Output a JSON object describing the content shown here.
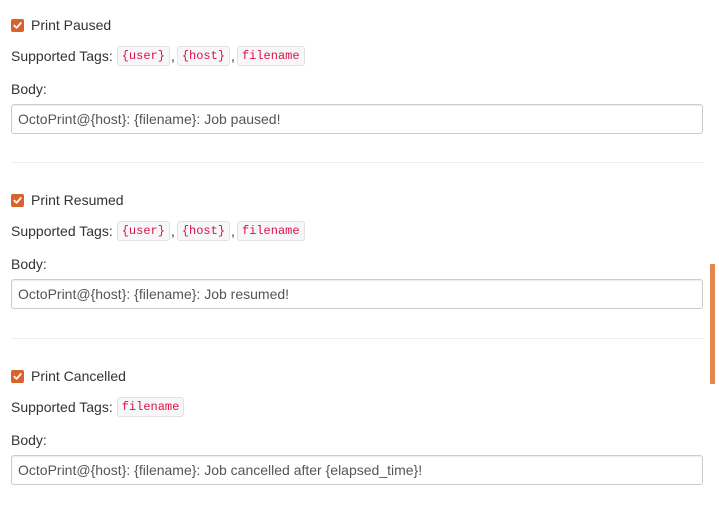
{
  "sections": [
    {
      "checkbox_label": "Print Paused",
      "checked": true,
      "tags_label": "Supported Tags:",
      "tags": [
        "{user}",
        "{host}",
        "filename"
      ],
      "body_label": "Body:",
      "body_value": "OctoPrint@{host}: {filename}: Job paused!"
    },
    {
      "checkbox_label": "Print Resumed",
      "checked": true,
      "tags_label": "Supported Tags:",
      "tags": [
        "{user}",
        "{host}",
        "filename"
      ],
      "body_label": "Body:",
      "body_value": "OctoPrint@{host}: {filename}: Job resumed!"
    },
    {
      "checkbox_label": "Print Cancelled",
      "checked": true,
      "tags_label": "Supported Tags:",
      "tags": [
        "filename"
      ],
      "body_label": "Body:",
      "body_value": "OctoPrint@{host}: {filename}: Job cancelled after {elapsed_time}!"
    }
  ],
  "tag_separator": ",",
  "colors": {
    "accent": "#d9612a",
    "tag_text": "#dd1144",
    "scrollbar": "#e4874f"
  }
}
